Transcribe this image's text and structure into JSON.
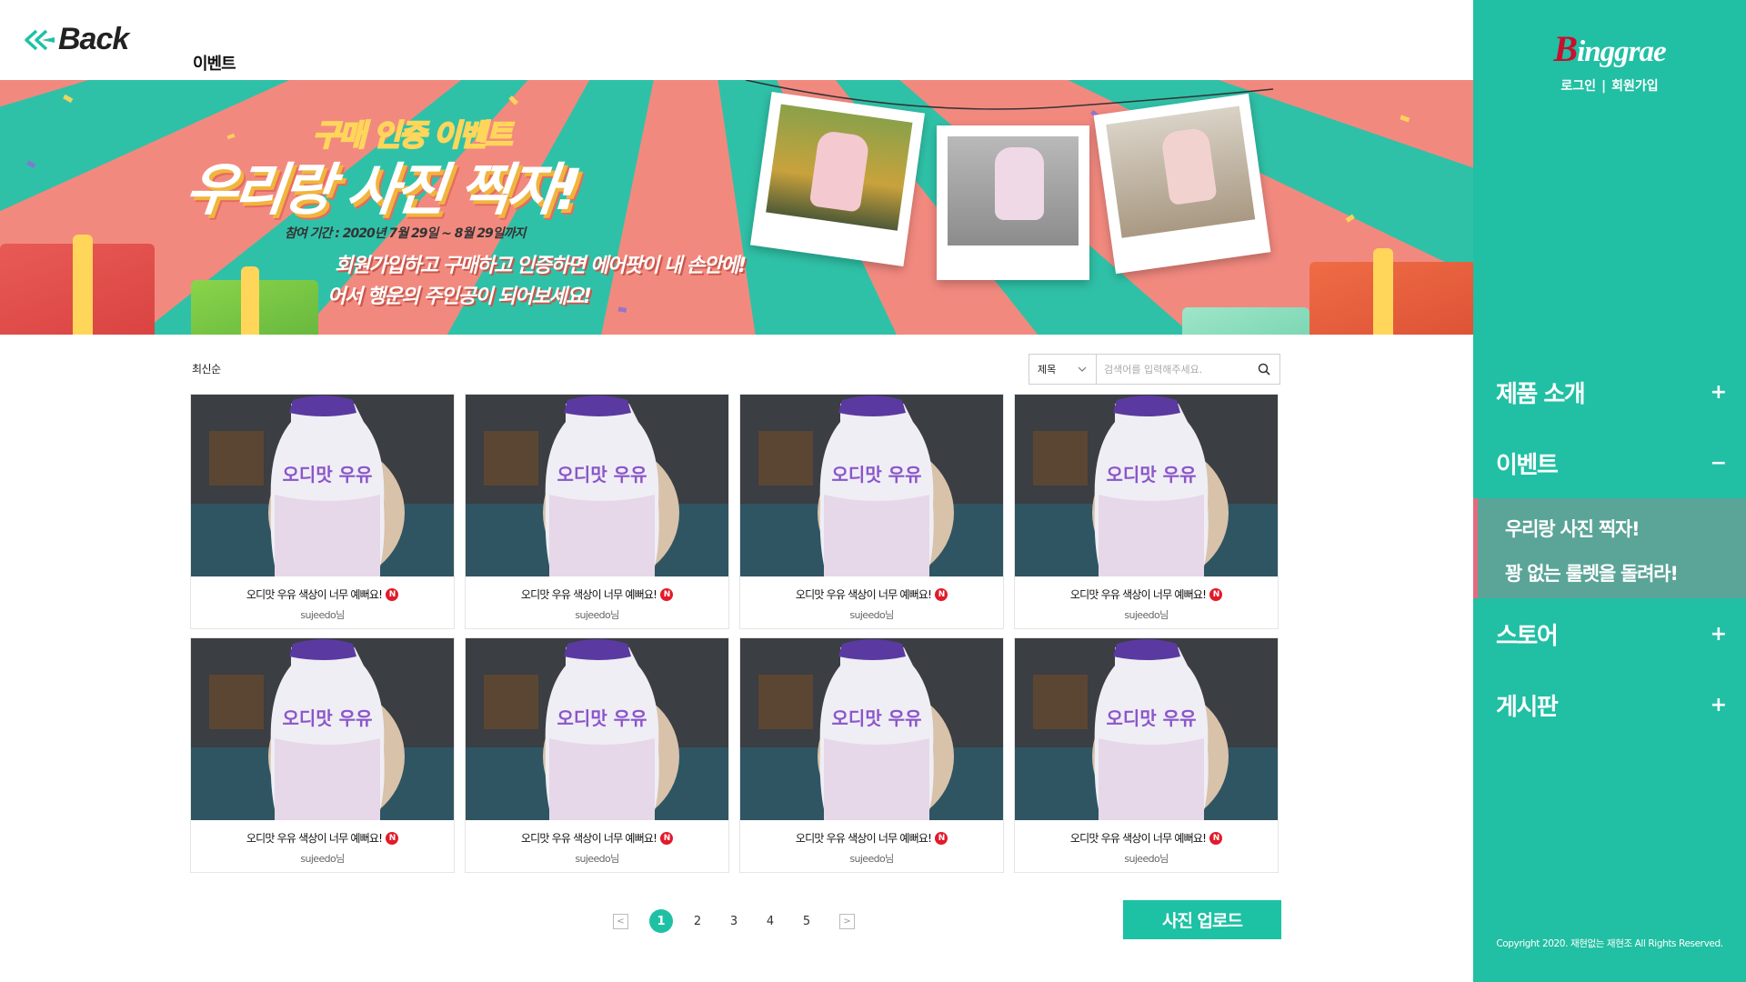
{
  "header": {
    "back_label": "Back",
    "page_title": "이벤트"
  },
  "banner": {
    "subtitle": "구매 인증 이벤트",
    "title": "우리랑 사진 찍자!",
    "period": "참여 기간 : 2020년 7월 29일 ~ 8월 29일까지",
    "line1": "회원가입하고 구매하고 인증하면 에어팟이 내 손안에!",
    "line2": "어서 행운의 주인공이 되어보세요!"
  },
  "toolbar": {
    "sort_label": "최신순",
    "search_select": "제목",
    "search_placeholder": "검색어를 입력해주세요."
  },
  "cards": [
    {
      "title": "오디맛 우유 색상이 너무 예뻐요!",
      "badge": "N",
      "author": "sujeedo님",
      "product_text": "오디맛 우유"
    },
    {
      "title": "오디맛 우유 색상이 너무 예뻐요!",
      "badge": "N",
      "author": "sujeedo님",
      "product_text": "오디맛 우유"
    },
    {
      "title": "오디맛 우유 색상이 너무 예뻐요!",
      "badge": "N",
      "author": "sujeedo님",
      "product_text": "오디맛 우유"
    },
    {
      "title": "오디맛 우유 색상이 너무 예뻐요!",
      "badge": "N",
      "author": "sujeedo님",
      "product_text": "오디맛 우유"
    },
    {
      "title": "오디맛 우유 색상이 너무 예뻐요!",
      "badge": "N",
      "author": "sujeedo님",
      "product_text": "오디맛 우유"
    },
    {
      "title": "오디맛 우유 색상이 너무 예뻐요!",
      "badge": "N",
      "author": "sujeedo님",
      "product_text": "오디맛 우유"
    },
    {
      "title": "오디맛 우유 색상이 너무 예뻐요!",
      "badge": "N",
      "author": "sujeedo님",
      "product_text": "오디맛 우유"
    },
    {
      "title": "오디맛 우유 색상이 너무 예뻐요!",
      "badge": "N",
      "author": "sujeedo님",
      "product_text": "오디맛 우유"
    }
  ],
  "pagination": {
    "prev": "<",
    "next": ">",
    "pages": [
      "1",
      "2",
      "3",
      "4",
      "5"
    ],
    "current": "1"
  },
  "upload_button": "사진 업로드",
  "sidebar": {
    "logo_initial": "B",
    "logo_rest": "inggrae",
    "login": "로그인",
    "separator": "|",
    "signup": "회원가입",
    "nav": [
      {
        "label": "제품 소개",
        "sign": "+"
      },
      {
        "label": "이벤트",
        "sign": "−",
        "expanded": true,
        "children": [
          "우리랑 사진 찍자!",
          "꽝 없는 룰렛을 돌려라!"
        ]
      },
      {
        "label": "스토어",
        "sign": "+"
      },
      {
        "label": "게시판",
        "sign": "+"
      }
    ],
    "copyright": "Copyright 2020. 재현없는 재현조 All Rights Reserved."
  },
  "colors": {
    "accent": "#1fc1a5",
    "sidebar_bg": "#21bfa3",
    "submenu_bg": "#5ba498",
    "submenu_marker": "#e46a7f",
    "new_badge": "#e11b2b",
    "banner_coral": "#f2897f",
    "banner_teal": "#2fc1a7"
  },
  "icons": {
    "back": "double-chevron-left-icon",
    "search": "search-icon",
    "select": "chevron-down-icon",
    "new": "new-badge-icon"
  }
}
